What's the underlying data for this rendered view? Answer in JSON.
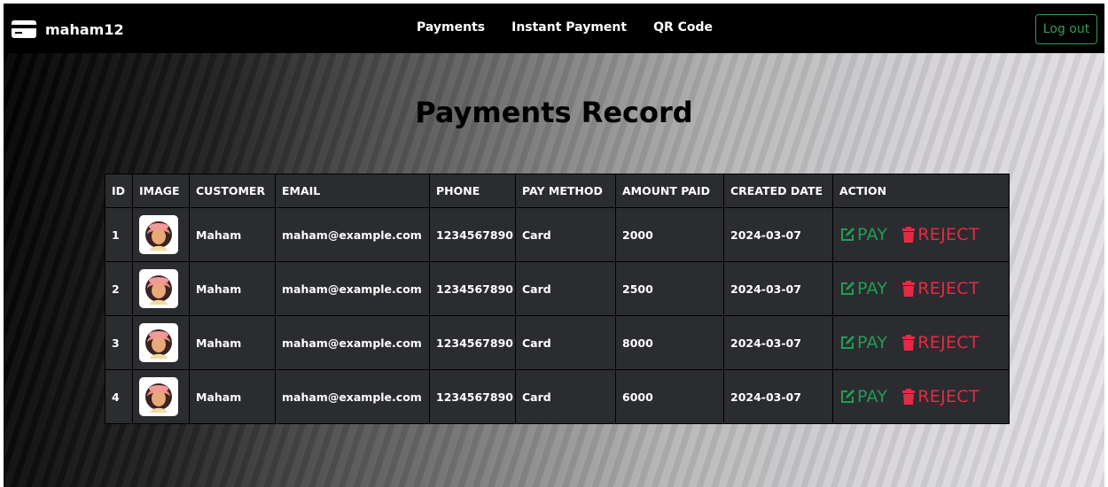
{
  "navbar": {
    "brand": "maham12",
    "brand_icon": "credit-card-icon",
    "links": [
      "Payments",
      "Instant Payment",
      "QR Code"
    ],
    "logout_label": "Log out"
  },
  "page": {
    "title": "Payments Record"
  },
  "table": {
    "headers": [
      "ID",
      "IMAGE",
      "CUSTOMER",
      "EMAIL",
      "PHONE",
      "PAY METHOD",
      "AMOUNT PAID",
      "CREATED DATE",
      "ACTION"
    ],
    "rows": [
      {
        "id": "1",
        "customer": "Maham",
        "email": "maham@example.com",
        "phone": "1234567890",
        "pay_method": "Card",
        "amount_paid": "2000",
        "created_date": "2024-03-07"
      },
      {
        "id": "2",
        "customer": "Maham",
        "email": "maham@example.com",
        "phone": "1234567890",
        "pay_method": "Card",
        "amount_paid": "2500",
        "created_date": "2024-03-07"
      },
      {
        "id": "3",
        "customer": "Maham",
        "email": "maham@example.com",
        "phone": "1234567890",
        "pay_method": "Card",
        "amount_paid": "8000",
        "created_date": "2024-03-07"
      },
      {
        "id": "4",
        "customer": "Maham",
        "email": "maham@example.com",
        "phone": "1234567890",
        "pay_method": "Card",
        "amount_paid": "6000",
        "created_date": "2024-03-07"
      }
    ],
    "actions": {
      "pay_label": "PAY",
      "pay_icon": "edit-icon",
      "reject_label": "REJECT",
      "reject_icon": "trash-icon"
    }
  },
  "colors": {
    "navbar_bg": "#000000",
    "table_bg": "#2b2c30",
    "pay_green": "#1f9e53",
    "reject_red": "#e52a43",
    "logout_green": "#2f9e57"
  }
}
